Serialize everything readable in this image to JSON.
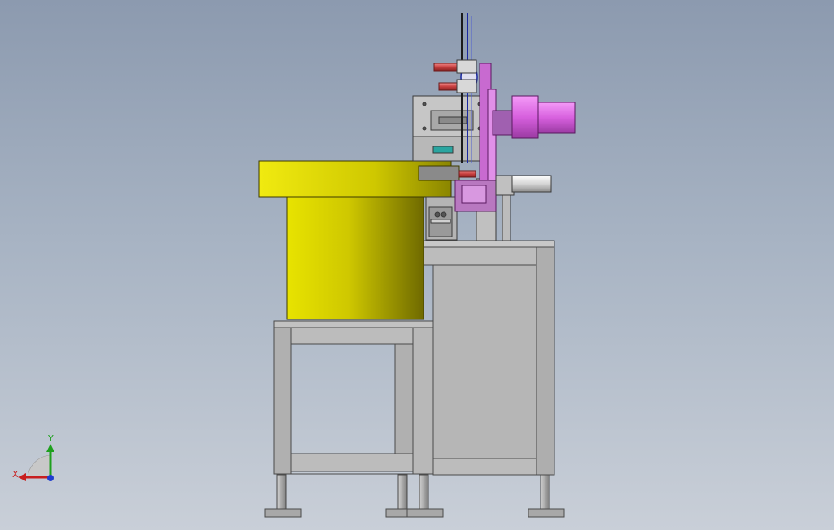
{
  "viewport": {
    "background_top": "#8c9aaf",
    "background_bottom": "#c9cfd8"
  },
  "colors": {
    "frame_gray": "#b4b4b4",
    "frame_edge": "#4a4a4a",
    "bowl_yellow": "#d6d000",
    "bowl_yellow_dark": "#7e7a00",
    "motor_magenta": "#e070e8",
    "motor_magenta_dark": "#8a2e94",
    "cylinder_silver": "#e8e8e8",
    "accent_blue": "#1a28a0",
    "accent_red": "#c84040",
    "foot_gray": "#a8a8a8"
  },
  "triad": {
    "x_label": "X",
    "y_label": "Y",
    "x_color": "#c81e1e",
    "y_color": "#1ea01e",
    "z_color": "#1e3ccf"
  },
  "icons": {
    "triad": "coordinate-triad-icon"
  }
}
